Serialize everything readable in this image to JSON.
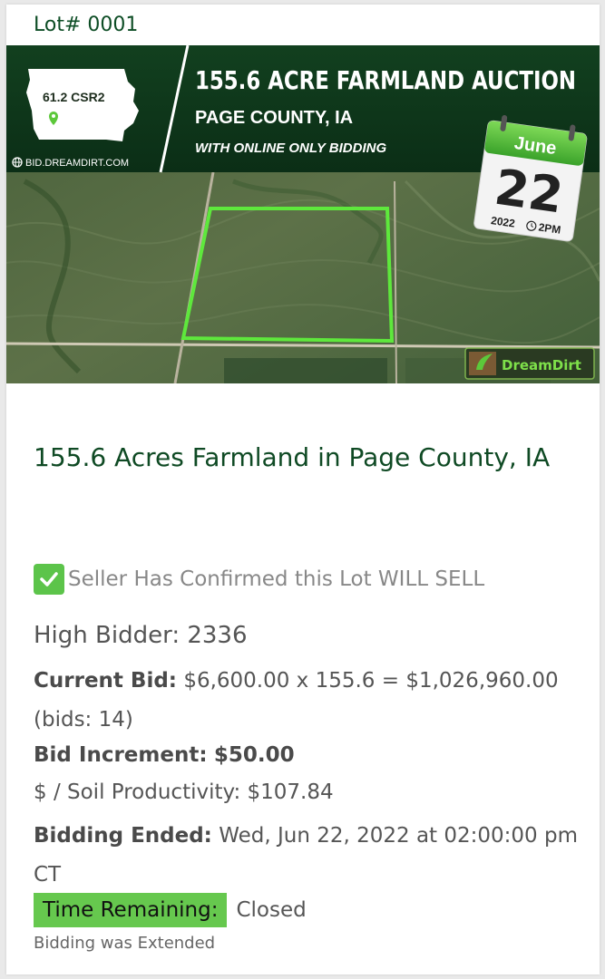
{
  "lot": {
    "label": "Lot# 0001"
  },
  "banner": {
    "map_csr": "61.2 CSR2",
    "website": "BID.DREAMDIRT.COM",
    "headline": "155.6 ACRE FARMLAND AUCTION",
    "county": "PAGE COUNTY, IA",
    "online_note": "WITH ONLINE ONLY BIDDING",
    "calendar_month": "June",
    "calendar_day": "22",
    "calendar_year": "2022",
    "calendar_time": "2PM",
    "brand": "DreamDirt",
    "accent_color": "#5cc83a",
    "dark_green": "#0e3b1c"
  },
  "listing": {
    "title": "155.6 Acres Farmland in Page County, IA",
    "confirm_text": "Seller Has Confirmed this Lot WILL SELL",
    "high_bidder": "High Bidder: 2336",
    "current_bid_label": "Current Bid:",
    "current_bid_value": "$6,600.00 x 155.6 = $1,026,960.00 (bids: 14)",
    "bid_increment_label": "Bid Increment:",
    "bid_increment_value": "$50.00",
    "soil_productivity": "$ / Soil Productivity: $107.84",
    "bidding_ended_label": "Bidding Ended:",
    "bidding_ended_value": "Wed, Jun 22, 2022 at 02:00:00 pm CT",
    "time_remaining_label": "Time Remaining:",
    "time_remaining_value": "Closed",
    "extended_note": "Bidding was Extended"
  }
}
